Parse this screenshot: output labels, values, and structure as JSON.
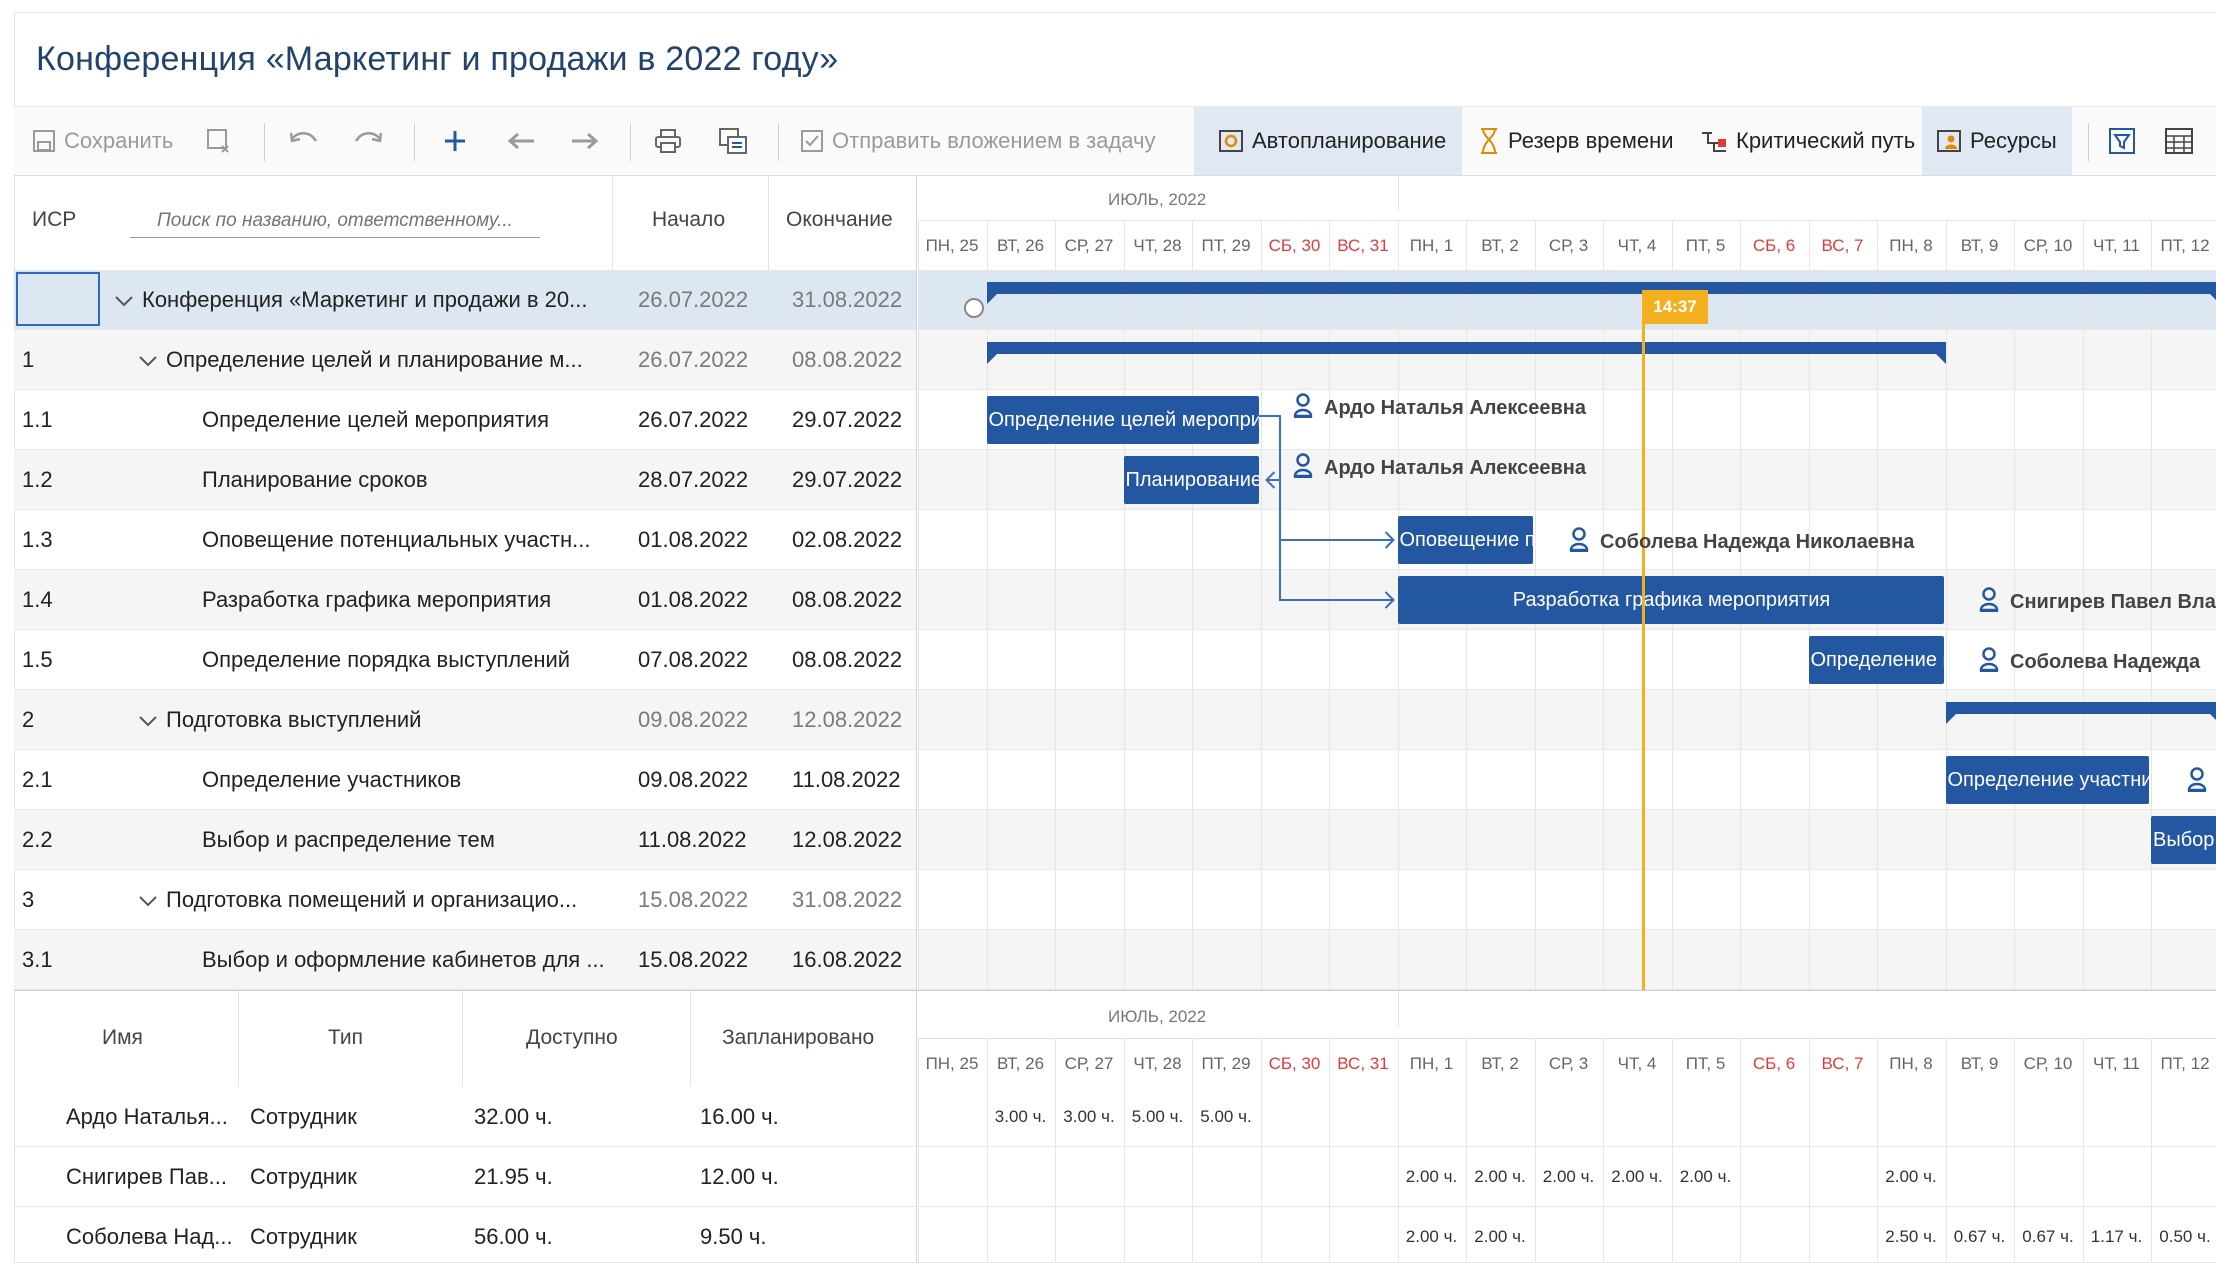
{
  "title": "Конференция «Маркетинг и продажи в 2022 году»",
  "toolbar": {
    "save": "Сохранить",
    "send_attachment": "Отправить вложением в задачу",
    "autoplan": "Автопланирование",
    "time_reserve": "Резерв времени",
    "critical_path": "Критический путь",
    "resources": "Ресурсы"
  },
  "grid": {
    "col_wbs": "ИСР",
    "search_placeholder": "Поиск по названию, ответственному...",
    "col_start": "Начало",
    "col_end": "Окончание",
    "rows": [
      {
        "wbs": "",
        "name": "Конференция «Маркетинг и продажи в 20...",
        "start": "26.07.2022",
        "end": "31.08.2022"
      },
      {
        "wbs": "1",
        "name": "Определение целей и планирование м...",
        "start": "26.07.2022",
        "end": "08.08.2022"
      },
      {
        "wbs": "1.1",
        "name": "Определение целей мероприятия",
        "start": "26.07.2022",
        "end": "29.07.2022"
      },
      {
        "wbs": "1.2",
        "name": "Планирование сроков",
        "start": "28.07.2022",
        "end": "29.07.2022"
      },
      {
        "wbs": "1.3",
        "name": "Оповещение потенциальных участн...",
        "start": "01.08.2022",
        "end": "02.08.2022"
      },
      {
        "wbs": "1.4",
        "name": "Разработка графика мероприятия",
        "start": "01.08.2022",
        "end": "08.08.2022"
      },
      {
        "wbs": "1.5",
        "name": "Определение порядка выступлений",
        "start": "07.08.2022",
        "end": "08.08.2022"
      },
      {
        "wbs": "2",
        "name": "Подготовка выступлений",
        "start": "09.08.2022",
        "end": "12.08.2022"
      },
      {
        "wbs": "2.1",
        "name": "Определение участников",
        "start": "09.08.2022",
        "end": "11.08.2022"
      },
      {
        "wbs": "2.2",
        "name": "Выбор и распределение тем",
        "start": "11.08.2022",
        "end": "12.08.2022"
      },
      {
        "wbs": "3",
        "name": "Подготовка помещений и организацио...",
        "start": "15.08.2022",
        "end": "31.08.2022"
      },
      {
        "wbs": "3.1",
        "name": "Выбор и оформление кабинетов для ...",
        "start": "15.08.2022",
        "end": "16.08.2022"
      }
    ]
  },
  "timeline": {
    "month": "ИЮЛЬ, 2022",
    "days": [
      "ПН, 25",
      "ВТ, 26",
      "СР, 27",
      "ЧТ, 28",
      "ПТ, 29",
      "СБ, 30",
      "ВС, 31",
      "ПН, 1",
      "ВТ, 2",
      "СР, 3",
      "ЧТ, 4",
      "ПТ, 5",
      "СБ, 6",
      "ВС, 7",
      "ПН, 8",
      "ВТ, 9",
      "СР, 10",
      "ЧТ, 11",
      "ПТ, 12"
    ],
    "now_label": "14:37"
  },
  "gantt": {
    "bars": {
      "b11": "Определение целей мероприятия",
      "b12": "Планирование сроков",
      "b13": "Оповещение потенциальных участников",
      "b14": "Разработка графика мероприятия",
      "b15": "Определение порядка выступлений",
      "b21": "Определение участников",
      "b22": "Выбор и распределение тем"
    },
    "res11": "Ардо Наталья Алексеевна",
    "res12": "Ардо Наталья Алексеевна",
    "res13": "Соболева Надежда Николаевна",
    "res14": "Снигирев Павел Вла",
    "res15": "Соболева Надежда"
  },
  "resources": {
    "col_name": "Имя",
    "col_type": "Тип",
    "col_available": "Доступно",
    "col_planned": "Запланировано",
    "rows": [
      {
        "name": "Ардо Наталья...",
        "type": "Сотрудник",
        "available": "32.00 ч.",
        "planned": "16.00 ч.",
        "hours": [
          "",
          "3.00 ч.",
          "3.00 ч.",
          "5.00 ч.",
          "5.00 ч.",
          "",
          "",
          "",
          "",
          "",
          "",
          "",
          "",
          "",
          "",
          "",
          "",
          "",
          ""
        ]
      },
      {
        "name": "Снигирев Пав...",
        "type": "Сотрудник",
        "available": "21.95 ч.",
        "planned": "12.00 ч.",
        "hours": [
          "",
          "",
          "",
          "",
          "",
          "",
          "",
          "2.00 ч.",
          "2.00 ч.",
          "2.00 ч.",
          "2.00 ч.",
          "2.00 ч.",
          "",
          "",
          "2.00 ч.",
          "",
          "",
          "",
          ""
        ]
      },
      {
        "name": "Соболева Над...",
        "type": "Сотрудник",
        "available": "56.00 ч.",
        "planned": "9.50 ч.",
        "hours": [
          "",
          "",
          "",
          "",
          "",
          "",
          "",
          "2.00 ч.",
          "2.00 ч.",
          "",
          "",
          "",
          "",
          "",
          "2.50 ч.",
          "0.67 ч.",
          "0.67 ч.",
          "1.17 ч.",
          "0.50 ч."
        ]
      }
    ]
  }
}
